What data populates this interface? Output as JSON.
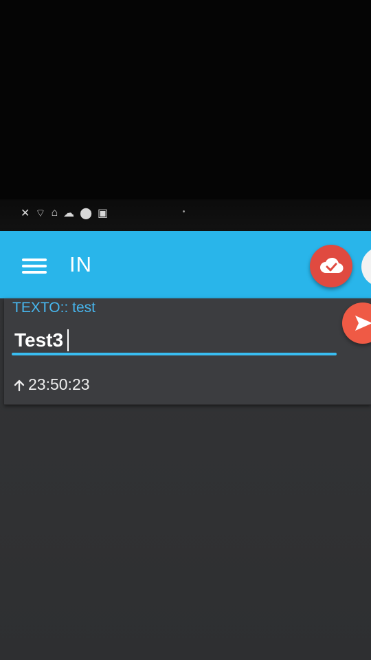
{
  "appbar": {
    "title": "IN",
    "accent": "#29b5ea"
  },
  "status_bar": {
    "icons": [
      "mute-icon",
      "wifi-icon",
      "home-icon",
      "cloud-icon",
      "location-icon",
      "mail-icon"
    ],
    "battery_label": "▏"
  },
  "message": {
    "label": "TEXTO:: test",
    "input_value": "Test3",
    "time": "23:50:23",
    "send_color": "#ef5a45",
    "cloud_color": "#e04a40"
  }
}
